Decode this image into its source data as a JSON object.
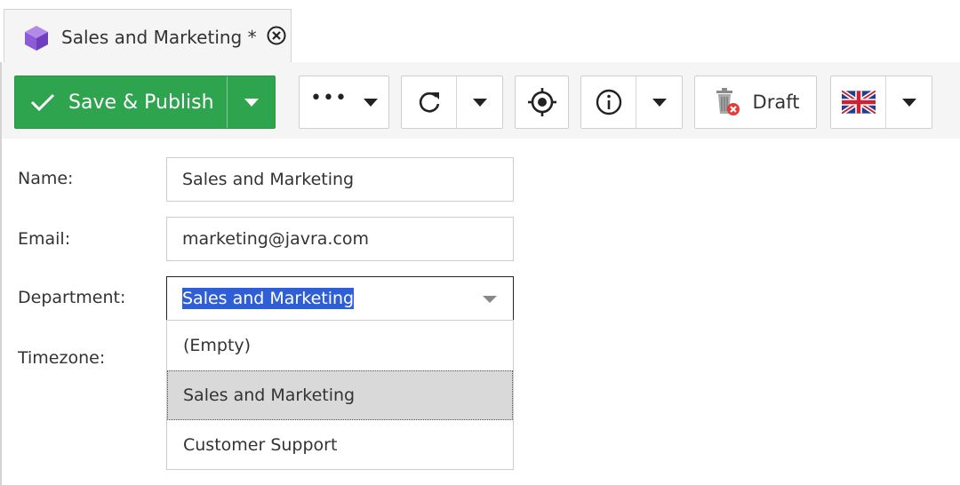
{
  "tab": {
    "title": "Sales and Marketing *",
    "icon": "cube-icon",
    "icon_color": "#8e5bd6"
  },
  "toolbar": {
    "save_label": "Save & Publish",
    "save_color": "#2ea44f",
    "draft_label": "Draft",
    "more_label": "•••",
    "language": "en-GB"
  },
  "form": {
    "name_label": "Name:",
    "name_value": "Sales and Marketing",
    "email_label": "Email:",
    "email_value": "marketing@javra.com",
    "department_label": "Department:",
    "department_value": "Sales and Marketing",
    "timezone_label": "Timezone:"
  },
  "department_dropdown": {
    "options": [
      "(Empty)",
      "Sales and Marketing",
      "Customer Support"
    ],
    "highlighted_index": 1
  }
}
